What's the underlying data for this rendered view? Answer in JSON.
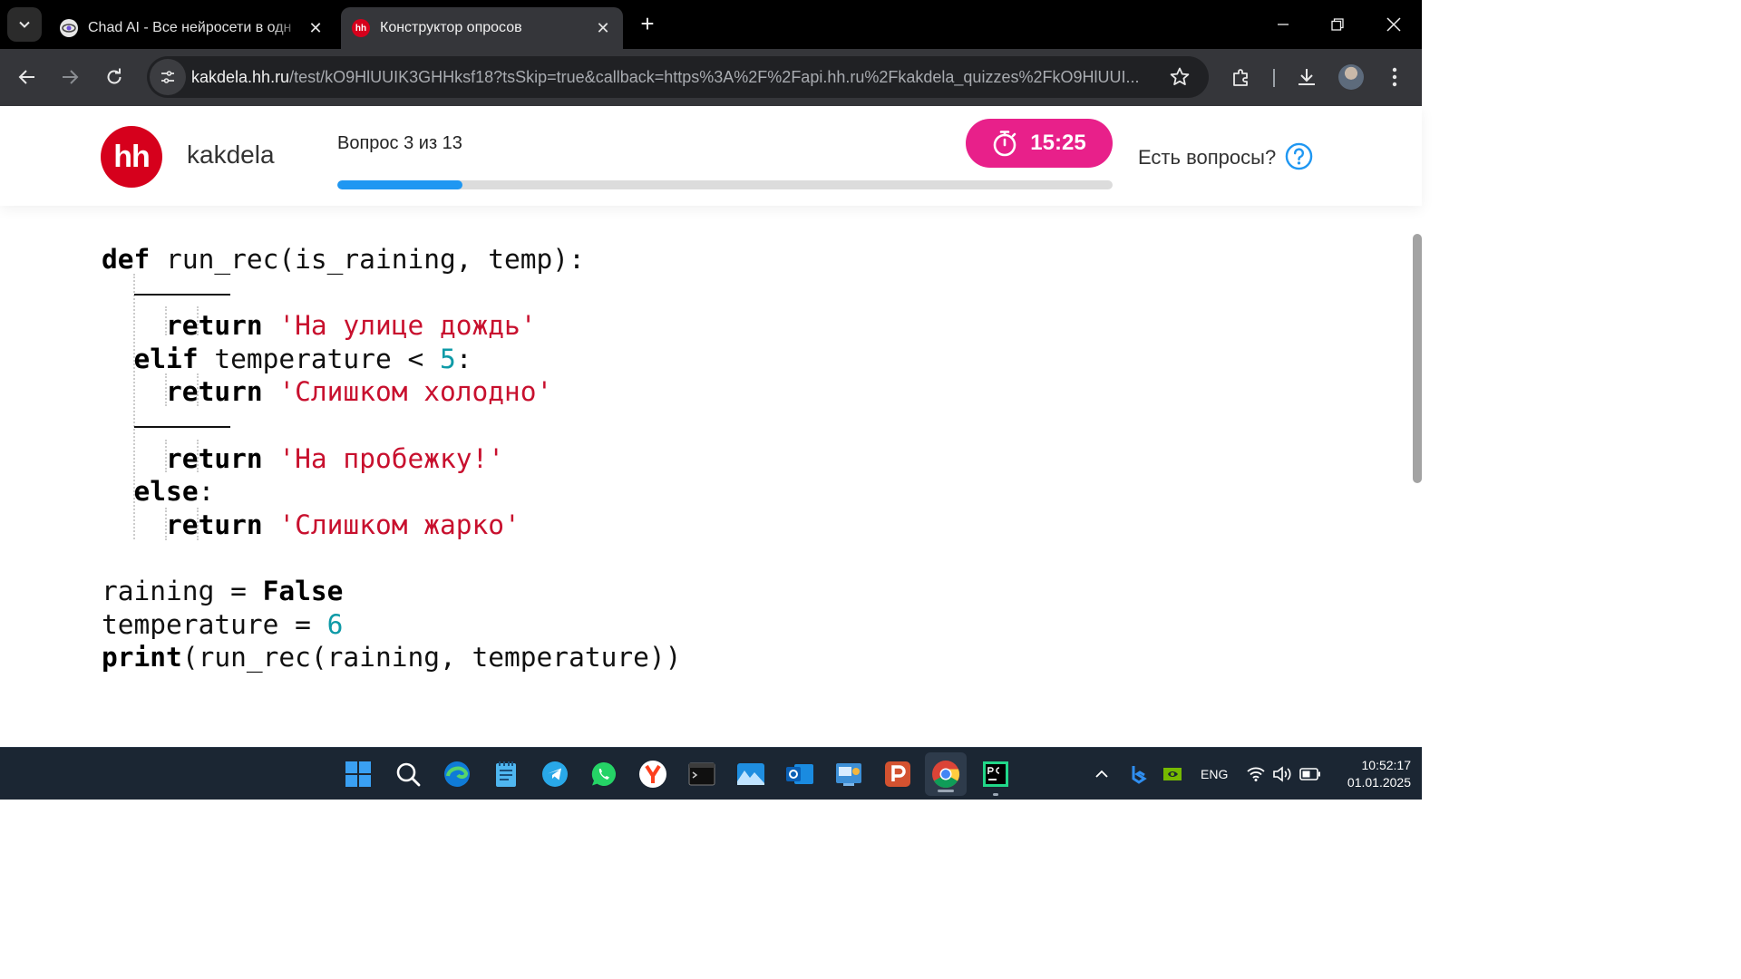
{
  "browser": {
    "tabs": [
      {
        "title": "Chad AI - Все нейросети в одн",
        "favicon": "chad-ai-favicon",
        "active": false
      },
      {
        "title": "Конструктор опросов",
        "favicon": "hh-favicon",
        "favicon_text": "hh",
        "active": true
      }
    ],
    "address_bar": {
      "domain": "kakdela.hh.ru",
      "path": "/test/kO9HlUUIK3GHHksf18?tsSkip=true&callback=https%3A%2F%2Fapi.hh.ru%2Fkakdela_quizzes%2FkO9HlUUI..."
    }
  },
  "header": {
    "logo_text": "hh",
    "brand": "kakdela",
    "progress_label": "Вопрос 3 из 13",
    "progress": {
      "current": 3,
      "total": 13
    },
    "timer": "15:25",
    "questions_label": "Есть вопросы?"
  },
  "code": {
    "line1": {
      "kw": "def",
      "rest": " run_rec(is_raining, temp):"
    },
    "line3": {
      "kw": "return",
      "str": "'На улице дождь'"
    },
    "line4": {
      "kw": "elif",
      "mid": " temperature < ",
      "num": "5",
      "end": ":"
    },
    "line5": {
      "kw": "return",
      "str": "'Слишком холодно'"
    },
    "line7": {
      "kw": "return",
      "str": "'На пробежку!'"
    },
    "line8": {
      "kw": "else",
      "end": ":"
    },
    "line9": {
      "kw": "return",
      "str": "'Слишком жарко'"
    },
    "line11": {
      "pre": "raining = ",
      "kw": "False"
    },
    "line12": {
      "pre": "temperature = ",
      "num": "6"
    },
    "line13": {
      "kw": "print",
      "rest": "(run_rec(raining, temperature))"
    }
  },
  "taskbar": {
    "apps": [
      "windows-start-icon",
      "search-icon",
      "edge-icon",
      "notepad-icon",
      "telegram-icon",
      "whatsapp-icon",
      "yandex-browser-icon",
      "terminal-icon",
      "photos-icon",
      "outlook-icon",
      "control-panel-icon",
      "powerpoint-icon",
      "chrome-icon",
      "pycharm-icon"
    ],
    "language": "ENG",
    "time": "10:52:17",
    "date": "01.01.2025"
  },
  "colors": {
    "accent_red": "#d6001c",
    "timer_pink": "#e8208a",
    "progress_blue": "#1f97f2",
    "string_red": "#c8102e",
    "number_teal": "#0e9aa7"
  }
}
